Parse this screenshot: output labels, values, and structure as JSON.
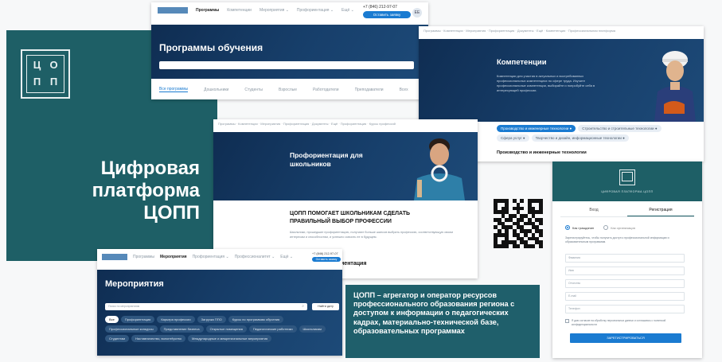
{
  "brand": {
    "title_lines": [
      "Цифровая",
      "платформа",
      "ЦОПП"
    ],
    "logo_letters": [
      "Ц",
      "О",
      "П",
      "П"
    ]
  },
  "top_site": {
    "nav": [
      "Программы",
      "Компетенции",
      "Мероприятия ⌄",
      "Профориентация ⌄",
      "Ещё ⌄"
    ],
    "phone": "+7 (846) 212-97-07",
    "cta": "Оставить заявку",
    "avatar": "ЕЕ",
    "page_title": "Программы обучения",
    "tabs": [
      "Все программы",
      "Дошкольники",
      "Студенты",
      "Взрослые",
      "Работодатели",
      "Преподаватели",
      "Всех"
    ]
  },
  "competencies": {
    "nav": "Программы · Компетенции · Мероприятия · Профориентация · Документы · Ещё · Компетенции · Профессиональная платформа",
    "title": "Компетенции",
    "desc": "Компетенции для участия в актуальных и востребованных профессиональных компетенциях по сфере труда. Изучите профессиональные компетенции, выбирайте и попробуйте себя в интересующей профессии.",
    "chips": [
      "Производство и инженерные технологии ●",
      "Строительство и строительные технологии ●",
      "Сфера услуг ●",
      "Творчество и дизайн, информационные технологии ●"
    ],
    "section": "Производство и инженерные технологии"
  },
  "career": {
    "nav": "Программы · Компетенции · Мероприятия · Профориентация · Документы · Ещё · Профориентация · Курсы профессий",
    "hero_title": "Профориентация для школьников",
    "heading": "ЦОПП ПОМОГАЕТ ШКОЛЬНИКАМ СДЕЛАТЬ ПРАВИЛЬНЫЙ ВЫБОР ПРОФЕССИИ",
    "body": "Школьники, прошедшие профориентацию, получают больше шансов выбрать профессию, соответствующую своим интересам и способностям, и успешно освоить ее в будущем.",
    "sub_heading": "иентация"
  },
  "events": {
    "nav": [
      "Программы",
      "Мероприятия",
      "Профориентация ⌄",
      "Профессионалитет ⌄",
      "Ещё ⌄"
    ],
    "phone": "+7 (846) 212-97-07",
    "cta": "Оставить заявку",
    "title": "Мероприятия",
    "search_placeholder": "Поиск по мероприятиям",
    "search_button": "Найти дату",
    "chips": [
      "Все",
      "Профориентация",
      "Карьера профессии",
      "Загрузка ППО",
      "Курсы по программам обучения",
      "Профессиональные конкурсы",
      "Представление бизнеса",
      "Открытые помещения",
      "Педагогические работники",
      "Школьникам",
      "Студентам",
      "Наставничество, волонтёрство",
      "Международные и межрегиональные мероприятия"
    ]
  },
  "auth": {
    "logo_caption": "ЦИФРОВАЯ ПЛАТФОРМА ЦОПП",
    "tabs": [
      "Вход",
      "Регистрация"
    ],
    "radio_options": [
      "Как гражданин",
      "Как организация"
    ],
    "info": "Зарегистрируйтесь, чтобы получить доступ к профессиональной информации и образовательным программам.",
    "field_labels": [
      "Фамилия",
      "Имя",
      "Отчество",
      "E-mail",
      "Телефон"
    ],
    "consent": "Я даю согласие на обработку персональных данных и соглашаюсь с политикой конфиденциальности",
    "submit": "ЗАРЕГИСТРИРОВАТЬСЯ"
  },
  "caption": "ЦОПП – агрегатор и оператор ресурсов профессионального образования региона с доступом к информации о педагогических кадрах, материально-технической базе, образовательных программах",
  "colors": {
    "teal": "#1e5f66",
    "navy": "#0f2d52",
    "blue": "#1a7bd1",
    "caption_bg": "#1f5f6b"
  }
}
